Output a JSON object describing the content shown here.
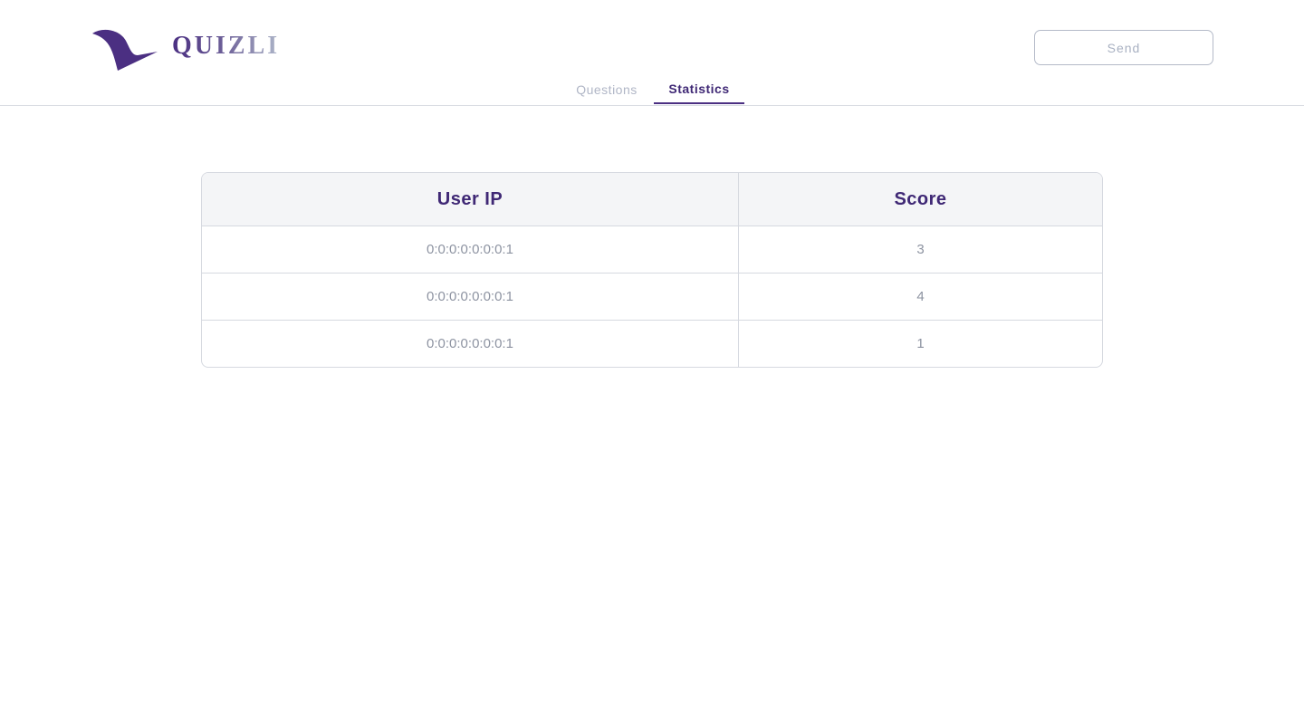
{
  "brand": {
    "name": "QUIZLI",
    "logo_icon": "bird-swoosh-icon",
    "accent": "#4b2f82"
  },
  "header": {
    "send_label": "Send"
  },
  "tabs": [
    {
      "label": "Questions",
      "active": false
    },
    {
      "label": "Statistics",
      "active": true
    }
  ],
  "statistics": {
    "columns": [
      "User IP",
      "Score"
    ],
    "rows": [
      {
        "ip": "0:0:0:0:0:0:0:1",
        "score": "3"
      },
      {
        "ip": "0:0:0:0:0:0:0:1",
        "score": "4"
      },
      {
        "ip": "0:0:0:0:0:0:0:1",
        "score": "1"
      }
    ]
  }
}
